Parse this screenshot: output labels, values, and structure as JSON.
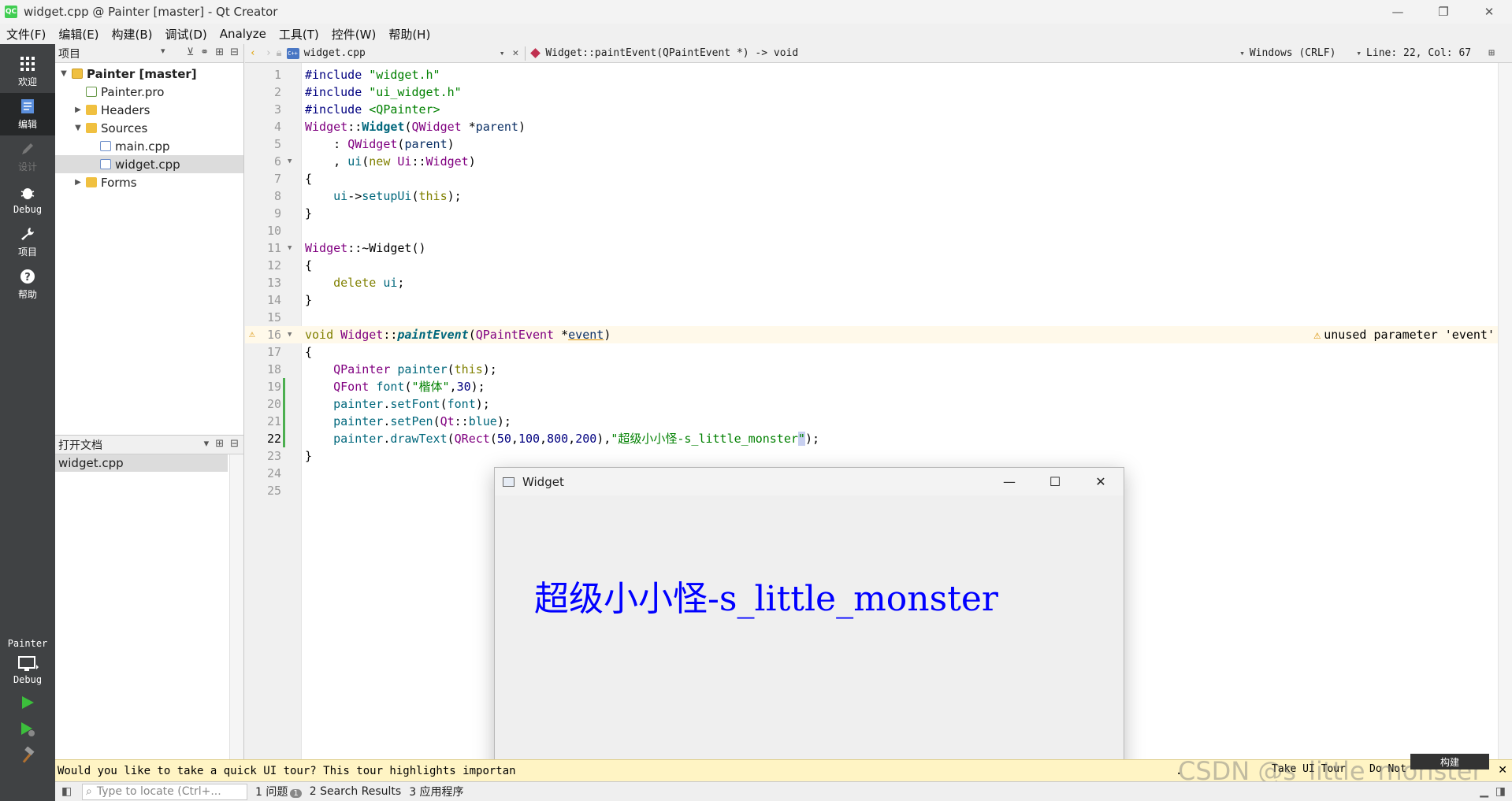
{
  "titlebar": {
    "app_icon": "QC",
    "title": "widget.cpp @ Painter [master] - Qt Creator",
    "minimize": "—",
    "restore": "❐",
    "close": "✕"
  },
  "menu": [
    "文件(F)",
    "编辑(E)",
    "构建(B)",
    "调试(D)",
    "Analyze",
    "工具(T)",
    "控件(W)",
    "帮助(H)"
  ],
  "modes": [
    {
      "label": "欢迎",
      "icon": "grid-icon"
    },
    {
      "label": "编辑",
      "icon": "edit-icon"
    },
    {
      "label": "设计",
      "icon": "pencil-icon"
    },
    {
      "label": "Debug",
      "icon": "bug-icon"
    },
    {
      "label": "项目",
      "icon": "wrench-icon"
    },
    {
      "label": "帮助",
      "icon": "help-icon"
    }
  ],
  "kit": {
    "project": "Painter",
    "config": "Debug"
  },
  "project_panel": {
    "title": "项目",
    "tree": [
      {
        "label": "Painter [master]",
        "level": 0,
        "type": "project",
        "arrow": "▼",
        "bold": true
      },
      {
        "label": "Painter.pro",
        "level": 1,
        "type": "pro",
        "arrow": ""
      },
      {
        "label": "Headers",
        "level": 1,
        "type": "folder",
        "arrow": "▶"
      },
      {
        "label": "Sources",
        "level": 1,
        "type": "folder",
        "arrow": "▼"
      },
      {
        "label": "main.cpp",
        "level": 2,
        "type": "file",
        "arrow": ""
      },
      {
        "label": "widget.cpp",
        "level": 2,
        "type": "file",
        "arrow": "",
        "selected": true
      },
      {
        "label": "Forms",
        "level": 1,
        "type": "folder",
        "arrow": "▶"
      }
    ]
  },
  "open_docs": {
    "title": "打开文档",
    "docs": [
      "widget.cpp"
    ]
  },
  "editor_toolbar": {
    "file_name": "widget.cpp",
    "symbol": "Widget::paintEvent(QPaintEvent *) -> void",
    "line_endings": "Windows (CRLF)",
    "position": "Line: 22, Col: 67"
  },
  "editor": {
    "current_line": 22,
    "warning_line": 16,
    "warning_text": "unused parameter 'event'",
    "lines": [
      {
        "n": "1",
        "text": "#include \"widget.h\""
      },
      {
        "n": "2",
        "text": "#include \"ui_widget.h\""
      },
      {
        "n": "3",
        "text": "#include <QPainter>"
      },
      {
        "n": "4",
        "text": "Widget::Widget(QWidget *parent)"
      },
      {
        "n": "5",
        "text": "    : QWidget(parent)"
      },
      {
        "n": "6",
        "text": "    , ui(new Ui::Widget)"
      },
      {
        "n": "7",
        "text": "{"
      },
      {
        "n": "8",
        "text": "    ui->setupUi(this);"
      },
      {
        "n": "9",
        "text": "}"
      },
      {
        "n": "10",
        "text": ""
      },
      {
        "n": "11",
        "text": "Widget::~Widget()"
      },
      {
        "n": "12",
        "text": "{"
      },
      {
        "n": "13",
        "text": "    delete ui;"
      },
      {
        "n": "14",
        "text": "}"
      },
      {
        "n": "15",
        "text": ""
      },
      {
        "n": "16",
        "text": "void Widget::paintEvent(QPaintEvent *event)"
      },
      {
        "n": "17",
        "text": "{"
      },
      {
        "n": "18",
        "text": "    QPainter painter(this);"
      },
      {
        "n": "19",
        "text": "    QFont font(\"楷体\",30);"
      },
      {
        "n": "20",
        "text": "    painter.setFont(font);"
      },
      {
        "n": "21",
        "text": "    painter.setPen(Qt::blue);"
      },
      {
        "n": "22",
        "text": "    painter.drawText(QRect(50,100,800,200),\"超级小小怪-s_little_monster\");"
      },
      {
        "n": "23",
        "text": "}"
      },
      {
        "n": "24",
        "text": ""
      },
      {
        "n": "25",
        "text": ""
      }
    ]
  },
  "widget_window": {
    "title": "Widget",
    "painted_text": "超级小小怪-s_little_monster",
    "text_color": "#0000ff"
  },
  "tour_bar": {
    "text": "Would you like to take a quick UI tour? This tour highlights importan",
    "text_end": ".",
    "take_tour": "Take UI Tour",
    "do_not_show": "Do Not",
    "close": "✕"
  },
  "build_popup": "构建",
  "watermark": "CSDN @s_little_monster",
  "statusbar": {
    "locate_placeholder": "Type to locate (Ctrl+...",
    "tabs": [
      {
        "label": "1 问题",
        "badge": "1"
      },
      {
        "label": "2 Search Results",
        "badge": ""
      },
      {
        "label": "3 应用程序",
        "badge": ""
      }
    ]
  },
  "colors": {
    "modebar": "#404244",
    "accent": "#41cd52",
    "warning": "#f3a600",
    "painted_text": "#0000ff"
  }
}
